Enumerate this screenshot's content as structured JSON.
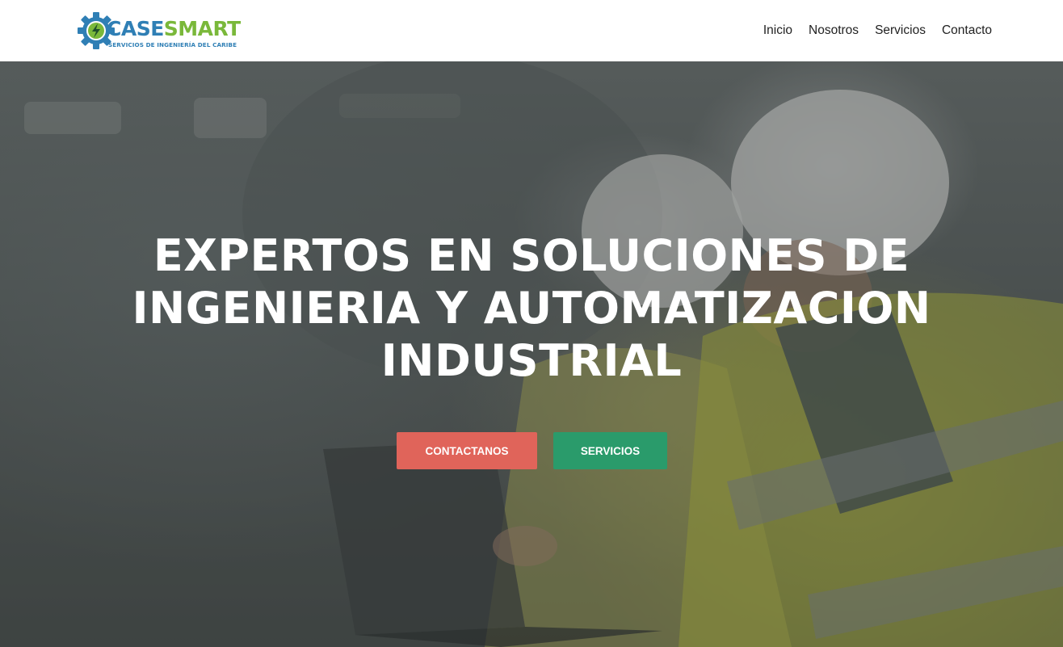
{
  "brand": {
    "name_part1": "CASE",
    "name_part2": "SMART",
    "tagline": "SERVICIOS DE INGENIERÍA DEL CARIBE",
    "colors": {
      "blue": "#2f7fb5",
      "green": "#7ab83a"
    },
    "icon": "gear-lightning-icon"
  },
  "nav": {
    "items": [
      {
        "label": "Inicio"
      },
      {
        "label": "Nosotros"
      },
      {
        "label": "Servicios"
      },
      {
        "label": "Contacto"
      }
    ]
  },
  "hero": {
    "title_line1": "EXPERTOS EN SOLUCIONES DE",
    "title_line2": "INGENIERIA Y AUTOMATIZACION",
    "title_line3": "INDUSTRIAL",
    "buttons": {
      "contact": {
        "label": "CONTACTANOS",
        "color": "#e0645a"
      },
      "services": {
        "label": "SERVICIOS",
        "color": "#2a9b6b"
      }
    }
  }
}
